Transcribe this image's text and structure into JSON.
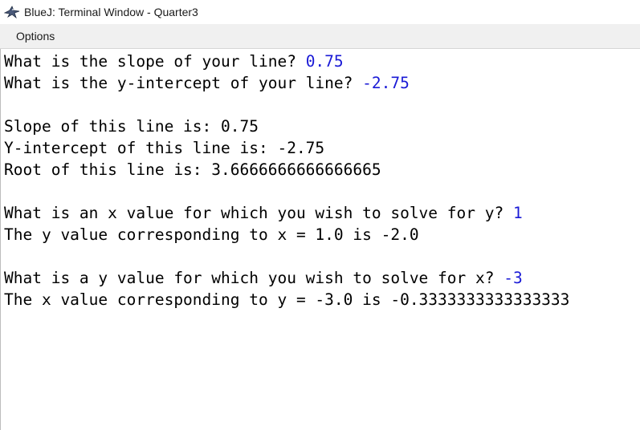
{
  "window": {
    "title": "BlueJ: Terminal Window - Quarter3",
    "icon": "bluej-bird-icon"
  },
  "menu": {
    "options_label": "Options"
  },
  "terminal": {
    "lines": [
      {
        "prompt": "What is the slope of your line? ",
        "input": "0.75"
      },
      {
        "prompt": "What is the y-intercept of your line? ",
        "input": "-2.75"
      },
      {
        "prompt": "",
        "input": ""
      },
      {
        "prompt": "Slope of this line is: 0.75",
        "input": ""
      },
      {
        "prompt": "Y-intercept of this line is: -2.75",
        "input": ""
      },
      {
        "prompt": "Root of this line is: 3.6666666666666665",
        "input": ""
      },
      {
        "prompt": "",
        "input": ""
      },
      {
        "prompt": "What is an x value for which you wish to solve for y? ",
        "input": "1"
      },
      {
        "prompt": "The y value corresponding to x = 1.0 is -2.0",
        "input": ""
      },
      {
        "prompt": "",
        "input": ""
      },
      {
        "prompt": "What is a y value for which you wish to solve for x? ",
        "input": "-3"
      },
      {
        "prompt": "The x value corresponding to y = -3.0 is -0.3333333333333333",
        "input": ""
      }
    ],
    "input_color": "#1a1ad6",
    "output_color": "#000000"
  }
}
